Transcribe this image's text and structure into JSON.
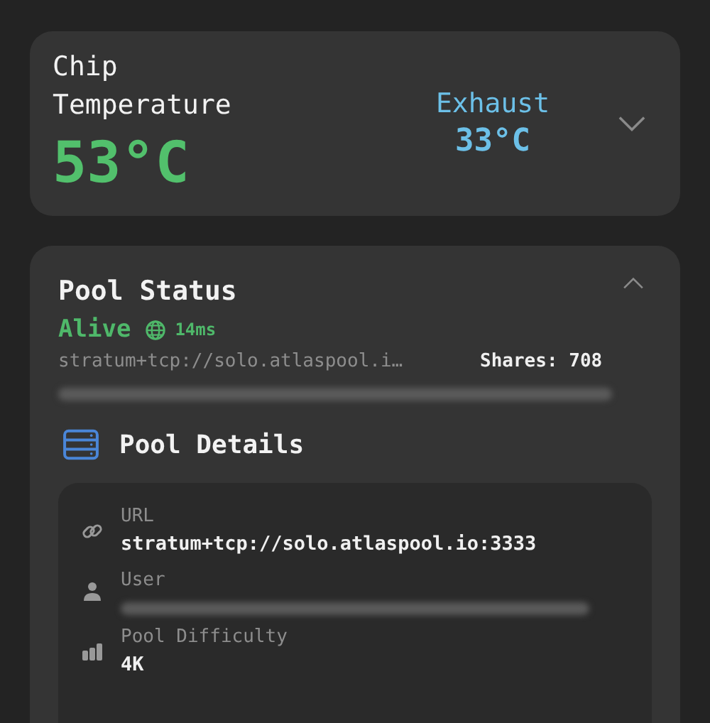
{
  "temperature_card": {
    "title": "Chip Temperature",
    "value": "53°C",
    "exhaust_label": "Exhaust",
    "exhaust_value": "33°C",
    "expanded": false
  },
  "pool_status": {
    "title": "Pool Status",
    "expanded": true,
    "status": "Alive",
    "latency": "14ms",
    "url": "stratum+tcp://solo.atlaspool.i…",
    "shares": "Shares: 708",
    "user_redacted": true,
    "details": {
      "title": "Pool Details",
      "rows": [
        {
          "kind": "link",
          "label": "URL",
          "value": "stratum+tcp://solo.atlaspool.io:3333"
        },
        {
          "kind": "user",
          "label": "User",
          "redacted": true
        },
        {
          "kind": "difficulty",
          "label": "Pool Difficulty",
          "value": "4K"
        }
      ]
    }
  }
}
